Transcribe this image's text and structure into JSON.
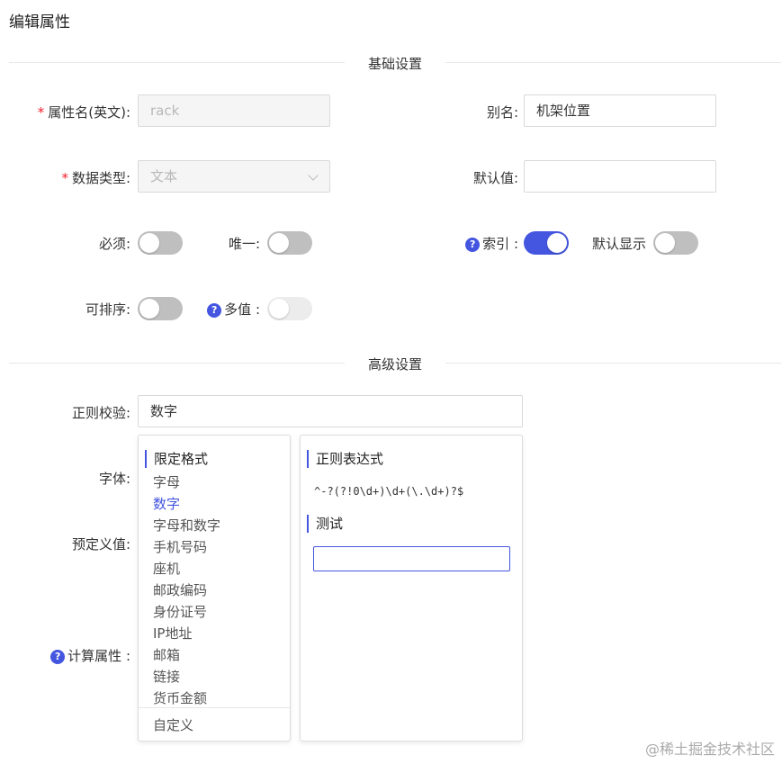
{
  "page": {
    "title": "编辑属性"
  },
  "sections": {
    "basic": "基础设置",
    "advanced": "高级设置"
  },
  "basic": {
    "attr_name": {
      "label": "属性名(英文):",
      "value": "rack"
    },
    "alias": {
      "label": "别名:",
      "value": "机架位置"
    },
    "data_type": {
      "label": "数据类型:",
      "value": "文本"
    },
    "default_value": {
      "label": "默认值:",
      "value": ""
    },
    "required": {
      "label": "必须:",
      "on": false
    },
    "unique": {
      "label": "唯一:",
      "on": false
    },
    "index": {
      "label": "索引 :",
      "on": true,
      "help_icon": "?"
    },
    "default_display": {
      "label": "默认显示",
      "on": false
    },
    "sortable": {
      "label": "可排序:",
      "on": false
    },
    "multi_value": {
      "label": "多值 :",
      "on": false,
      "disabled": true,
      "help_icon": "?"
    }
  },
  "advanced": {
    "regex_check": {
      "label": "正则校验:",
      "value": "数字"
    },
    "font": {
      "label": "字体:"
    },
    "predefined": {
      "label": "预定义值:"
    },
    "computed": {
      "label": "计算属性 :",
      "help_icon": "?"
    }
  },
  "dropdown": {
    "format_header": "限定格式",
    "formats": [
      "字母",
      "数字",
      "字母和数字",
      "手机号码",
      "座机",
      "邮政编码",
      "身份证号",
      "IP地址",
      "邮箱",
      "链接",
      "货币金额"
    ],
    "active_format": "数字",
    "custom": "自定义",
    "regex_header": "正则表达式",
    "regex_value": "^-?(?!0\\d+)\\d+(\\.\\d+)?$",
    "test_header": "测试",
    "test_value": ""
  },
  "watermark": "@稀土掘金技术社区",
  "colors": {
    "accent": "#4456e0",
    "required": "#f5222d",
    "switch_off": "#bfbfbf"
  }
}
